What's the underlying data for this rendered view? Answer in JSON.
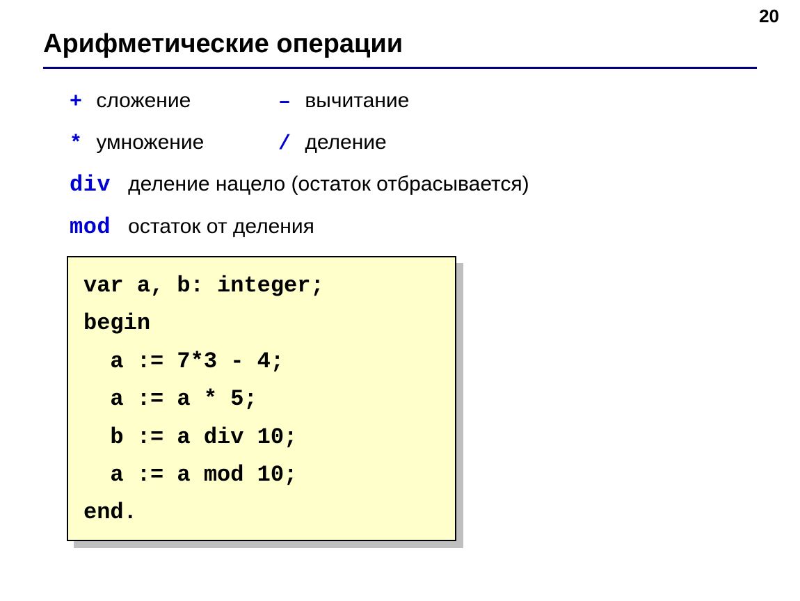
{
  "page_number": "20",
  "title": "Арифметические операции",
  "ops": {
    "plus": {
      "sym": "+",
      "label": "сложение"
    },
    "minus": {
      "sym": "–",
      "label": "вычитание"
    },
    "mul": {
      "sym": "*",
      "label": "умножение"
    },
    "div": {
      "sym": "/",
      "label": "деление"
    },
    "divkw": {
      "sym": "div",
      "label": "деление нацело (остаток отбрасывается)"
    },
    "modkw": {
      "sym": "mod",
      "label": "остаток от деления"
    }
  },
  "code": {
    "l1": "var a, b: integer;",
    "l2": "begin",
    "l3": "  a := 7*3 - 4;",
    "l4": "  a := a * 5;",
    "l5": "  b := a div 10;",
    "l6": "  a := a mod 10;",
    "l7": "end."
  }
}
